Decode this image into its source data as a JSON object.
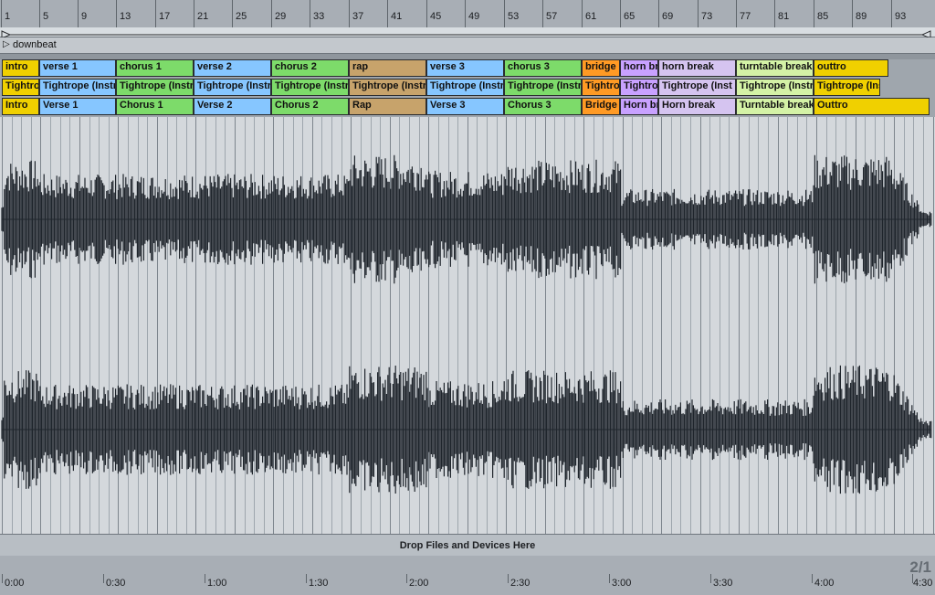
{
  "ruler": {
    "bars": [
      "1",
      "5",
      "9",
      "13",
      "17",
      "21",
      "25",
      "29",
      "33",
      "37",
      "41",
      "45",
      "49",
      "53",
      "57",
      "61",
      "65",
      "69",
      "73",
      "77",
      "81",
      "85",
      "89",
      "93"
    ]
  },
  "markers": {
    "label": "downbeat"
  },
  "tracks": {
    "sections": [
      {
        "label": "intro",
        "color": "#f0d000"
      },
      {
        "label": "verse 1",
        "color": "#86c6ff"
      },
      {
        "label": "chorus 1",
        "color": "#7ddb6a"
      },
      {
        "label": "verse 2",
        "color": "#86c6ff"
      },
      {
        "label": "chorus 2",
        "color": "#7ddb6a"
      },
      {
        "label": "rap",
        "color": "#c7a36b"
      },
      {
        "label": "verse 3",
        "color": "#86c6ff"
      },
      {
        "label": "chorus 3",
        "color": "#7ddb6a"
      },
      {
        "label": "bridge",
        "color": "#ff9a24"
      },
      {
        "label": "horn br",
        "color": "#c8a1ff"
      },
      {
        "label": "horn break",
        "color": "#d5c4f0"
      },
      {
        "label": "turntable break",
        "color": "#d4f2a6"
      },
      {
        "label": "outtro",
        "color": "#f0d000"
      }
    ],
    "clips": [
      {
        "label": "Tightro",
        "color": "#f0d000"
      },
      {
        "label": "Tightrope (Instr",
        "color": "#86c6ff"
      },
      {
        "label": "Tightrope (Instr",
        "color": "#7ddb6a"
      },
      {
        "label": "Tightrope (Instr",
        "color": "#86c6ff"
      },
      {
        "label": "Tightrope (Instr",
        "color": "#7ddb6a"
      },
      {
        "label": "Tightrope (Instr",
        "color": "#c7a36b"
      },
      {
        "label": "Tightrope (Instr",
        "color": "#86c6ff"
      },
      {
        "label": "Tightrope (Instr",
        "color": "#7ddb6a"
      },
      {
        "label": "Tightro",
        "color": "#ff9a24"
      },
      {
        "label": "Tightro",
        "color": "#c8a1ff"
      },
      {
        "label": "Tightrope (Inst",
        "color": "#d5c4f0"
      },
      {
        "label": "Tightrope (Instr",
        "color": "#d4f2a6"
      },
      {
        "label": "Tightrope (Ins",
        "color": "#f0d000"
      }
    ],
    "labels": [
      {
        "label": "Intro",
        "color": "#f0d000"
      },
      {
        "label": "Verse 1",
        "color": "#86c6ff"
      },
      {
        "label": "Chorus 1",
        "color": "#7ddb6a"
      },
      {
        "label": "Verse 2",
        "color": "#86c6ff"
      },
      {
        "label": "Chorus 2",
        "color": "#7ddb6a"
      },
      {
        "label": "Rap",
        "color": "#c7a36b"
      },
      {
        "label": "Verse 3",
        "color": "#86c6ff"
      },
      {
        "label": "Chorus 3",
        "color": "#7ddb6a"
      },
      {
        "label": "Bridge",
        "color": "#ff9a24"
      },
      {
        "label": "Horn br",
        "color": "#c8a1ff"
      },
      {
        "label": "Horn break",
        "color": "#d5c4f0"
      },
      {
        "label": "Turntable break",
        "color": "#d4f2a6"
      },
      {
        "label": "Outtro",
        "color": "#f0d000"
      }
    ]
  },
  "drop": {
    "label": "Drop Files and Devices Here"
  },
  "time_ruler": {
    "labels": [
      "0:00",
      "0:30",
      "1:00",
      "1:30",
      "2:00",
      "2:30",
      "3:00",
      "3:30",
      "4:00",
      "4:30"
    ]
  },
  "corner": {
    "label": "2/1"
  }
}
